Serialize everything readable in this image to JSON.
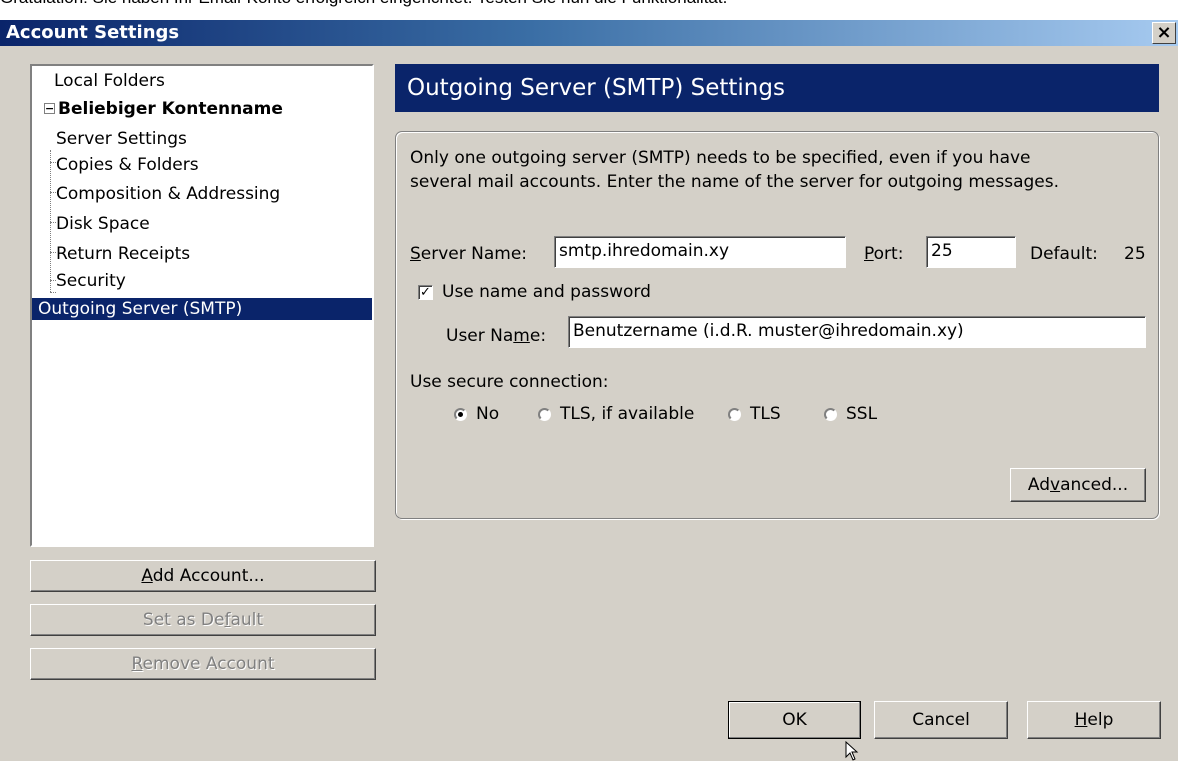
{
  "caption": "Gratulation! Sie haben Ihr Email-Konto erfolgreich eingerichtet. Testen Sie nun die Funktionalität.",
  "window": {
    "title": "Account Settings",
    "close_glyph": "×"
  },
  "tree": {
    "items": [
      {
        "label": "Local Folders"
      },
      {
        "label": "Beliebiger Kontenname",
        "expand_glyph": "−"
      },
      {
        "label": "Server Settings"
      },
      {
        "label": "Copies & Folders"
      },
      {
        "label": "Composition & Addressing"
      },
      {
        "label": "Disk Space"
      },
      {
        "label": "Return Receipts"
      },
      {
        "label": "Security"
      },
      {
        "label": "Outgoing Server (SMTP)"
      }
    ]
  },
  "left_buttons": {
    "add_account": {
      "pre": "",
      "key": "A",
      "post": "dd Account..."
    },
    "set_default": {
      "pre": "Set as De",
      "key": "f",
      "post": "ault"
    },
    "remove_account": {
      "pre": "",
      "key": "R",
      "post": "emove Account"
    }
  },
  "panel": {
    "header": "Outgoing Server (SMTP) Settings",
    "description_line1": "Only one outgoing server (SMTP) needs to be specified, even if you have",
    "description_line2": "several mail accounts. Enter the name of the server for outgoing messages.",
    "server_name_label": {
      "pre": "",
      "key": "S",
      "post": "erver Name:"
    },
    "server_name_value": "smtp.ihredomain.xy",
    "port_label": {
      "pre": "",
      "key": "P",
      "post": "ort:"
    },
    "port_value": "25",
    "default_label": "Default:",
    "default_value": "25",
    "use_auth_label": "Use name and password",
    "use_auth_checked": true,
    "check_glyph": "✓",
    "user_name_label": {
      "pre": "User Na",
      "key": "m",
      "post": "e:"
    },
    "user_name_value": "Benutzername (i.d.R. muster@ihredomain.xy)",
    "secure_label": "Use secure connection:",
    "secure_options": [
      {
        "label": "No",
        "selected": true
      },
      {
        "label": "TLS, if available",
        "selected": false
      },
      {
        "label": "TLS",
        "selected": false
      },
      {
        "label": "SSL",
        "selected": false
      }
    ],
    "advanced_button": {
      "pre": "Ad",
      "key": "v",
      "post": "anced..."
    }
  },
  "footer_buttons": {
    "ok": "OK",
    "cancel": "Cancel",
    "help": {
      "pre": "",
      "key": "H",
      "post": "elp"
    }
  }
}
